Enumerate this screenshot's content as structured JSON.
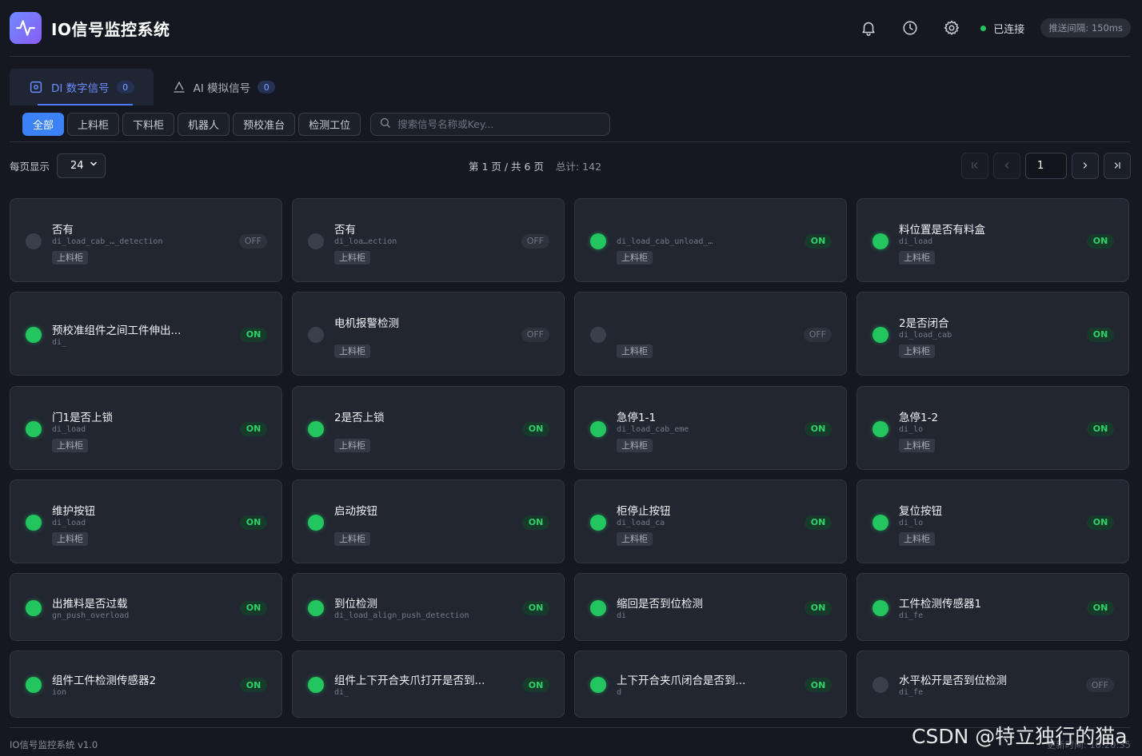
{
  "app": {
    "title": "IO信号监控系统"
  },
  "header": {
    "connection": "已连接",
    "interval": "推送间隔: 150ms"
  },
  "tabs": [
    {
      "label": "DI 数字信号",
      "count": "0"
    },
    {
      "label": "AI 模拟信号",
      "count": "0"
    }
  ],
  "filters": [
    "全部",
    "上料柜",
    "下料柜",
    "机器人",
    "预校准台",
    "检测工位"
  ],
  "search": {
    "placeholder": "搜索信号名称或Key..."
  },
  "pagination": {
    "per_page_label": "每页显示",
    "per_page_value": "24",
    "page_info": "第 1 页 / 共 6 页",
    "total": "总计: 142",
    "current_page": "1"
  },
  "signals": [
    {
      "name": "否有",
      "key": "di_load_cab_…_detection",
      "tag": "上料柜",
      "state": "OFF"
    },
    {
      "name": "否有",
      "key": "di_loa…ection",
      "tag": "上料柜",
      "state": "OFF"
    },
    {
      "name": "",
      "key": "di_load_cab_unload_…",
      "tag": "上料柜",
      "state": "ON"
    },
    {
      "name": "料位置是否有料盒",
      "key": "di_load",
      "tag": "上料柜",
      "state": "ON"
    },
    {
      "name": "预校准组件之间工件伸出...",
      "key": "di_",
      "tag": "",
      "state": "ON"
    },
    {
      "name": "电机报警检测",
      "key": "",
      "tag": "上料柜",
      "state": "OFF"
    },
    {
      "name": "",
      "key": "",
      "tag": "上料柜",
      "state": "OFF"
    },
    {
      "name": "2是否闭合",
      "key": "di_load_cab",
      "tag": "上料柜",
      "state": "ON"
    },
    {
      "name": "门1是否上锁",
      "key": "di_load",
      "tag": "上料柜",
      "state": "ON"
    },
    {
      "name": "2是否上锁",
      "key": "",
      "tag": "上料柜",
      "state": "ON"
    },
    {
      "name": "急停1-1",
      "key": "di_load_cab_eme",
      "tag": "上料柜",
      "state": "ON"
    },
    {
      "name": "急停1-2",
      "key": "di_lo",
      "tag": "上料柜",
      "state": "ON"
    },
    {
      "name": "维护按钮",
      "key": "di_load",
      "tag": "上料柜",
      "state": "ON"
    },
    {
      "name": "启动按钮",
      "key": "",
      "tag": "上料柜",
      "state": "ON"
    },
    {
      "name": "柜停止按钮",
      "key": "di_load_ca",
      "tag": "上料柜",
      "state": "ON"
    },
    {
      "name": "复位按钮",
      "key": "di_lo",
      "tag": "上料柜",
      "state": "ON"
    },
    {
      "name": "出推料是否过载",
      "key": "gn_push_overload",
      "tag": "",
      "state": "ON"
    },
    {
      "name": "到位检测",
      "key": "di_load_align_push_detection",
      "tag": "",
      "state": "ON"
    },
    {
      "name": "缩回是否到位检测",
      "key": "di",
      "tag": "",
      "state": "ON"
    },
    {
      "name": "工件检测传感器1",
      "key": "di_fe",
      "tag": "",
      "state": "ON"
    },
    {
      "name": "组件工件检测传感器2",
      "key": "ion",
      "tag": "",
      "state": "ON"
    },
    {
      "name": "组件上下开合夹爪打开是否到...",
      "key": "di_",
      "tag": "",
      "state": "ON"
    },
    {
      "name": "上下开合夹爪闭合是否到...",
      "key": "d",
      "tag": "",
      "state": "ON"
    },
    {
      "name": "水平松开是否到位检测",
      "key": "di_fe",
      "tag": "",
      "state": "OFF"
    }
  ],
  "footer": {
    "version": "IO信号监控系统 v1.0",
    "updated": "更新时间: 10:20:35"
  },
  "watermark": "CSDN @特立独行的猫a",
  "colors": {
    "accent": "#3b82f6",
    "on": "#22c55e",
    "background": "#151821",
    "card": "#222631"
  }
}
